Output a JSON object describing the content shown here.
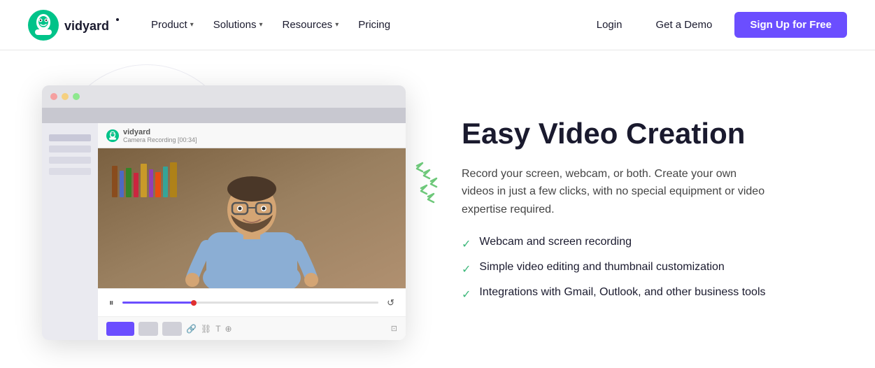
{
  "nav": {
    "logo_text": "vidyard",
    "links": [
      {
        "label": "Product",
        "has_chevron": true
      },
      {
        "label": "Solutions",
        "has_chevron": true
      },
      {
        "label": "Resources",
        "has_chevron": true
      },
      {
        "label": "Pricing",
        "has_chevron": false
      }
    ],
    "login_label": "Login",
    "demo_label": "Get a Demo",
    "signup_label": "Sign Up for Free"
  },
  "hero": {
    "title": "Easy Video Creation",
    "description": "Record your screen, webcam, or both. Create your own videos in just a few clicks, with no special equipment or video expertise required.",
    "features": [
      "Webcam and screen recording",
      "Simple video editing and thumbnail customization",
      "Integrations with Gmail, Outlook, and other business tools"
    ],
    "browser": {
      "toolbar_brand": "vidyard",
      "recording_label": "Camera Recording [00:34]"
    }
  }
}
